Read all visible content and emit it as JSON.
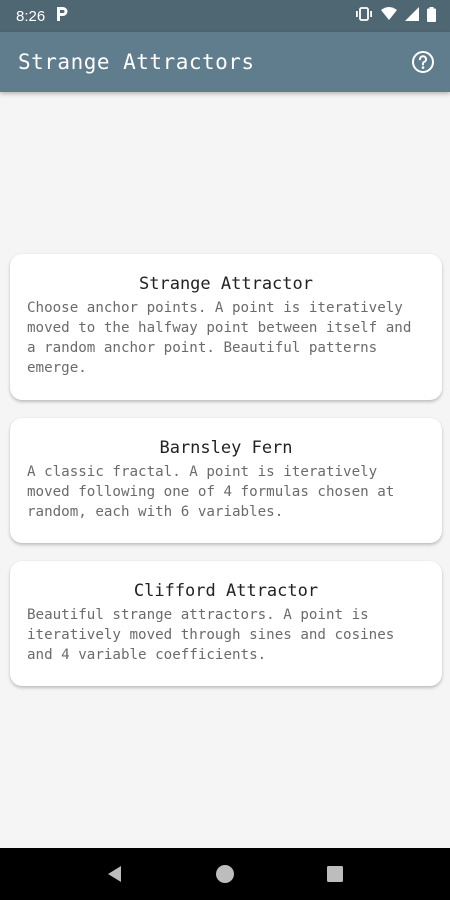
{
  "status_bar": {
    "time": "8:26",
    "notification_icon": "p-icon",
    "icons": [
      "vibrate-icon",
      "wifi-icon",
      "signal-icon",
      "battery-icon"
    ]
  },
  "app_bar": {
    "title": "Strange Attractors",
    "help_icon": "help-icon"
  },
  "cards": [
    {
      "title": "Strange Attractor",
      "description": "Choose anchor points. A point is iteratively moved to the halfway point between itself and a random anchor point. Beautiful patterns emerge."
    },
    {
      "title": "Barnsley Fern",
      "description": "A classic fractal. A point is iteratively moved following one of 4 formulas chosen at random, each with 6 variables."
    },
    {
      "title": "Clifford Attractor",
      "description": "Beautiful strange attractors. A point is iteratively moved through sines and cosines and 4 variable coefficients."
    }
  ],
  "nav_bar": {
    "buttons": [
      "back-icon",
      "home-icon",
      "recents-icon"
    ]
  },
  "colors": {
    "status_bar": "#4f6673",
    "app_bar": "#5f7d8d",
    "background": "#f5f5f5",
    "card": "#ffffff"
  }
}
